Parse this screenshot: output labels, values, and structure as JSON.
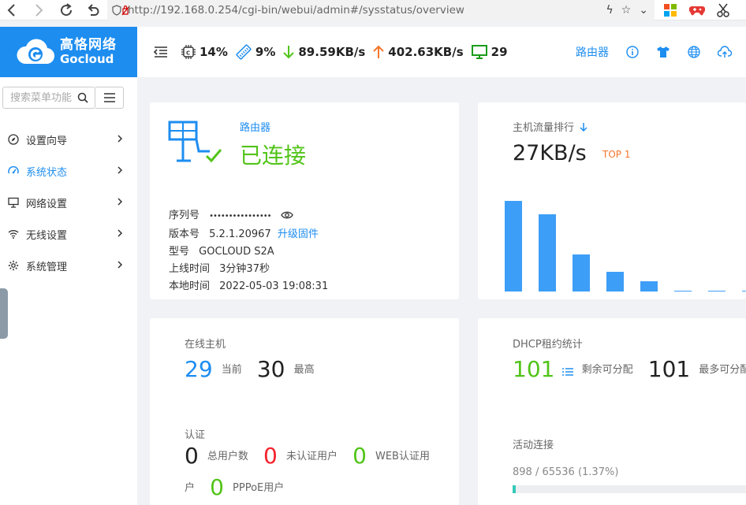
{
  "browser": {
    "url": "http://192.168.0.254/cgi-bin/webui/admin#/sysstatus/overview"
  },
  "brand": {
    "name_cn": "高恪网络",
    "name_en": "Gocloud"
  },
  "topbar": {
    "cpu": "14%",
    "mem": "9%",
    "down": "89.59KB/s",
    "up": "402.63KB/s",
    "hosts": "29",
    "router_label": "路由器"
  },
  "sidebar": {
    "search_placeholder": "搜索菜单功能",
    "items": [
      {
        "label": "设置向导",
        "icon": "compass-icon"
      },
      {
        "label": "系统状态",
        "icon": "dashboard-icon"
      },
      {
        "label": "网络设置",
        "icon": "monitor-icon"
      },
      {
        "label": "无线设置",
        "icon": "wifi-icon"
      },
      {
        "label": "系统管理",
        "icon": "gear-icon"
      }
    ]
  },
  "router": {
    "type_label": "路由器",
    "status": "已连接",
    "serial_label": "序列号",
    "serial_value": "••••••••••••••••",
    "version_label": "版本号",
    "version_value": "5.2.1.20967",
    "upgrade_link": "升级固件",
    "model_label": "型号",
    "model_value": "GOCLOUD S2A",
    "uptime_label": "上线时间",
    "uptime_value": "3分钟37秒",
    "localtime_label": "本地时间",
    "localtime_value": "2022-05-03 19:08:31"
  },
  "traffic": {
    "title": "主机流量排行",
    "value": "27KB/s",
    "badge": "TOP 1",
    "bars": [
      115,
      98,
      47,
      25,
      13,
      1,
      1,
      1
    ]
  },
  "online": {
    "title": "在线主机",
    "current": "29",
    "current_label": "当前",
    "max": "30",
    "max_label": "最高",
    "auth_title": "认证",
    "total_users": "0",
    "total_users_label": "总用户数",
    "unauth_users": "0",
    "unauth_users_label": "未认证用户",
    "web_users": "0",
    "web_users_label": "WEB认证用",
    "web_users_label_cont": "户",
    "pppoe_users": "0",
    "pppoe_users_label": "PPPoE用户"
  },
  "dhcp": {
    "title": "DHCP租约统计",
    "remaining": "101",
    "remaining_label": "剩余可分配",
    "max": "101",
    "max_label": "最多可分配",
    "conn_title": "活动连接",
    "conn_value": "898 / 65536 (1.37%)",
    "conn_fraction": 0.0137
  },
  "colors": {
    "brand": "#1d8df0",
    "green": "#52c41a",
    "red": "#f5222d",
    "orange": "#f5762a",
    "bar": "#3d9ef7"
  }
}
